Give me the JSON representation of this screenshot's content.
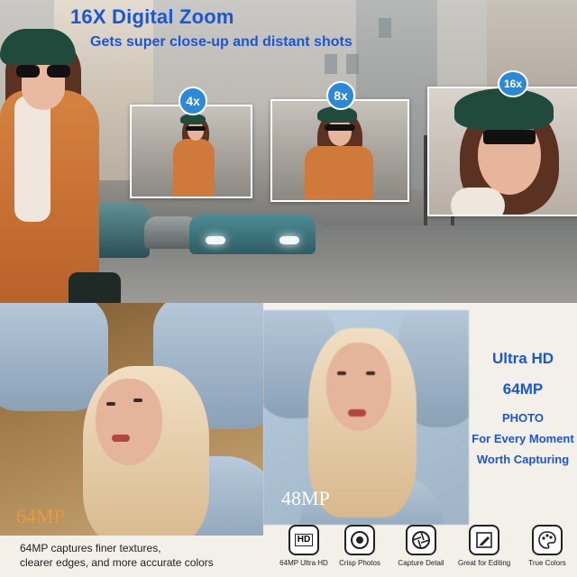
{
  "headline": "16X Digital Zoom",
  "subheadline": "Gets super close-up and distant shots",
  "zoom_levels": [
    {
      "label": "4x"
    },
    {
      "label": "8x"
    },
    {
      "label": "16x"
    }
  ],
  "photo_labels": {
    "left": "64MP",
    "right": "48MP"
  },
  "ultra_hd": {
    "line1": "Ultra HD",
    "line2": "64MP",
    "line3": "PHOTO",
    "line4": "For Every Moment",
    "line5": "Worth Capturing"
  },
  "caption": {
    "line1": "64MP captures finer textures,",
    "line2": "clearer edges, and more accurate colors"
  },
  "features": [
    {
      "label": "64MP Ultra HD",
      "icon": "hd-icon"
    },
    {
      "label": "Crisp Photos",
      "icon": "lens-icon"
    },
    {
      "label": "Capture Detail",
      "icon": "aperture-icon"
    },
    {
      "label": "Great for Editing",
      "icon": "edit-icon"
    },
    {
      "label": "True Colors",
      "icon": "palette-icon"
    }
  ],
  "colors": {
    "accent_blue": "#1b56d6",
    "badge_blue": "#2b8ad8",
    "label_orange": "#e89a3d"
  }
}
